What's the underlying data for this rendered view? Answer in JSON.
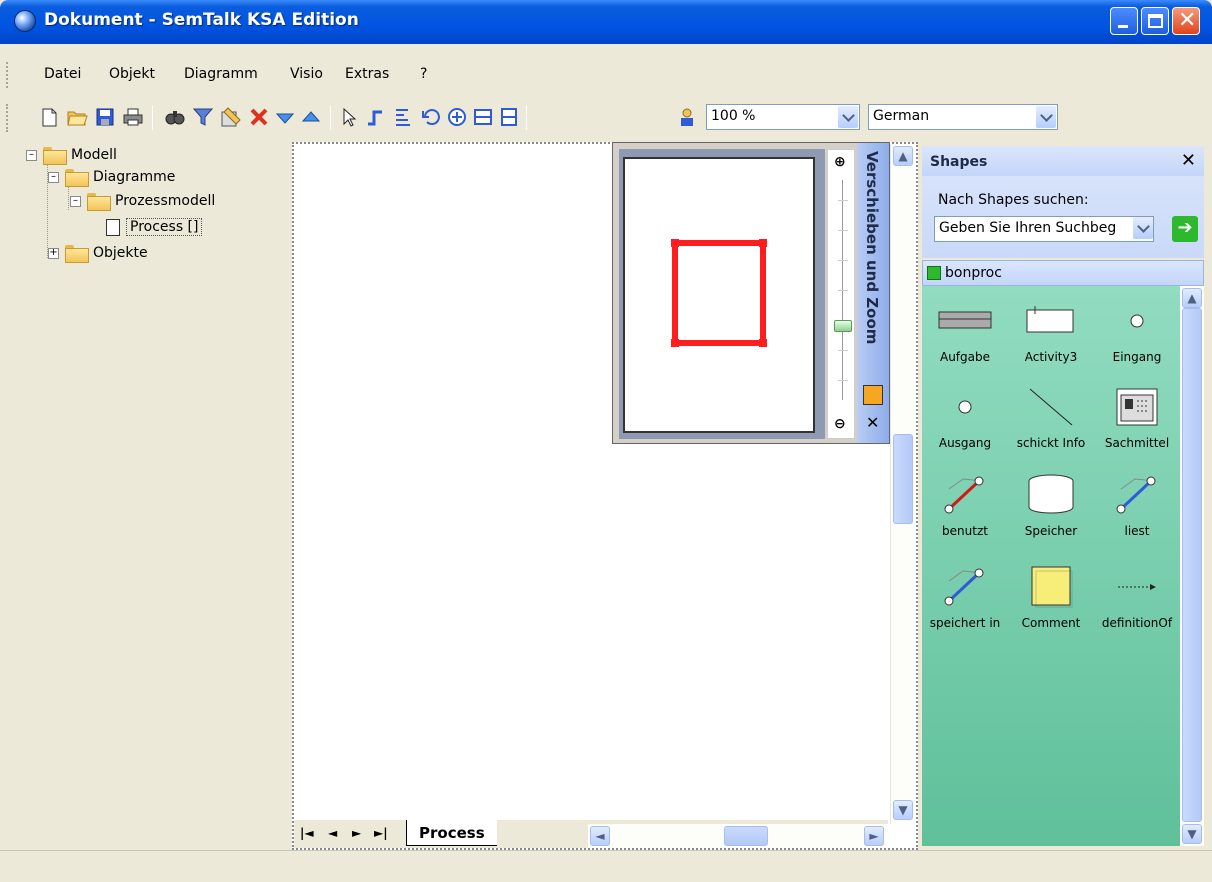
{
  "window": {
    "title": "Dokument - SemTalk KSA Edition"
  },
  "menu": [
    "Datei",
    "Objekt",
    "Diagramm",
    "Visio",
    "Extras",
    "?"
  ],
  "toolbar": {
    "zoom_value": "100 %",
    "language_value": "German",
    "colors": {
      "delete": "#e03020",
      "accent": "#2f5bd8"
    }
  },
  "tree": {
    "root": "Modell",
    "diagrams": "Diagramme",
    "process_model": "Prozessmodell",
    "process": "Process []",
    "objects": "Objekte"
  },
  "canvas": {
    "page_tab": "Process",
    "nav": {
      "first": "|◄",
      "prev": "◄",
      "next": "►",
      "last": "►|"
    }
  },
  "pan_zoom": {
    "title": "Verschieben und Zoom",
    "view_rect_color": "#ff1e1e"
  },
  "shapes_panel": {
    "title": "Shapes",
    "search_label": "Nach Shapes suchen:",
    "search_value": "Geben Sie Ihren Suchbeg",
    "stencil": "bonproc",
    "items": [
      {
        "label": "Aufgabe",
        "icon": "task-icon"
      },
      {
        "label": "Activity3",
        "icon": "activity-icon"
      },
      {
        "label": "Eingang",
        "icon": "input-circle-icon"
      },
      {
        "label": "Ausgang",
        "icon": "output-circle-icon"
      },
      {
        "label": "schickt Info",
        "icon": "connector-line-icon"
      },
      {
        "label": "Sachmittel",
        "icon": "resource-icon"
      },
      {
        "label": "benutzt",
        "icon": "uses-connector-icon"
      },
      {
        "label": "Speicher",
        "icon": "storage-icon"
      },
      {
        "label": "liest",
        "icon": "reads-connector-icon"
      },
      {
        "label": "speichert in",
        "icon": "stores-connector-icon"
      },
      {
        "label": "Comment",
        "icon": "comment-icon"
      },
      {
        "label": "definitionOf",
        "icon": "dotted-arrow-icon"
      }
    ],
    "stencil_bg": "#7dd0b0"
  }
}
